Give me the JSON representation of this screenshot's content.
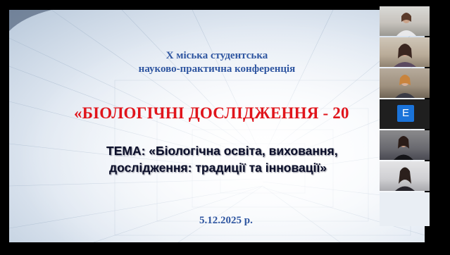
{
  "slide": {
    "conference_line1": "X міська студентська",
    "conference_line2": "науково-практична конференція",
    "title": "«БІОЛОГІЧНІ ДОСЛІДЖЕННЯ - 20",
    "theme_line1": "ТЕМА: «Біологічна освіта, виховання,",
    "theme_line2": "дослідження: традиції та інновації»",
    "date": "5.12.2025 р."
  },
  "participants": [
    {
      "type": "video",
      "name": ""
    },
    {
      "type": "video",
      "name": ""
    },
    {
      "type": "video",
      "name": ""
    },
    {
      "type": "avatar",
      "letter": "E",
      "name": ""
    },
    {
      "type": "video",
      "name": ""
    },
    {
      "type": "video",
      "name": ""
    },
    {
      "type": "empty",
      "name": ""
    }
  ],
  "colors": {
    "conference_text": "#2e55a0",
    "title_red": "#e0141b",
    "theme_text": "#0b0f2a",
    "avatar_blue": "#1a73d9"
  }
}
